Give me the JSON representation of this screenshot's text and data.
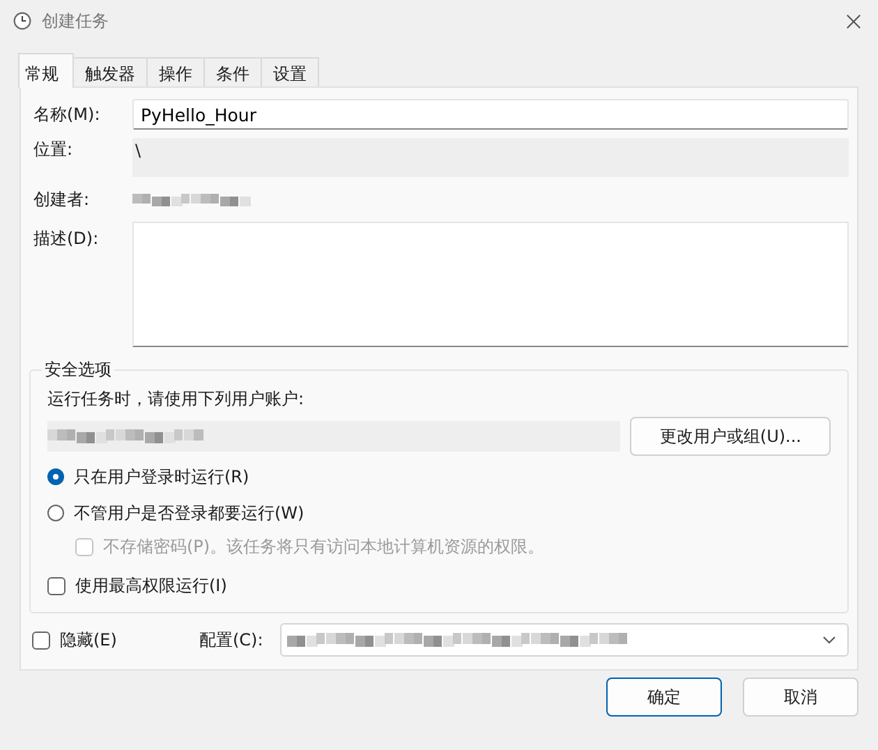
{
  "window": {
    "title": "创建任务"
  },
  "tabs": [
    {
      "label": "常规",
      "selected": true
    },
    {
      "label": "触发器",
      "selected": false
    },
    {
      "label": "操作",
      "selected": false
    },
    {
      "label": "条件",
      "selected": false
    },
    {
      "label": "设置",
      "selected": false
    }
  ],
  "general": {
    "name": {
      "label": "名称(M):",
      "value": "PyHello_Hour"
    },
    "location": {
      "label": "位置:",
      "value": "\\"
    },
    "author": {
      "label": "创建者:"
    },
    "description": {
      "label": "描述(D):"
    }
  },
  "security": {
    "title": "安全选项",
    "prompt": "运行任务时，请使用下列用户账户:",
    "change_button": "更改用户或组(U)...",
    "run_options": [
      {
        "label": "只在用户登录时运行(R)",
        "selected": true
      },
      {
        "label": "不管用户是否登录都要运行(W)",
        "selected": false,
        "children": [
          {
            "label": "不存储密码(P)。该任务将只有访问本地计算机资源的权限。",
            "checked": false,
            "disabled": true
          }
        ]
      }
    ],
    "highest": {
      "label": "使用最高权限运行(I)",
      "checked": false
    }
  },
  "hidden": {
    "label": "隐藏(E)",
    "checked": false
  },
  "config": {
    "label": "配置(C):"
  },
  "buttons": [
    {
      "label": "确定",
      "default": true
    },
    {
      "label": "取消",
      "default": false
    }
  ]
}
